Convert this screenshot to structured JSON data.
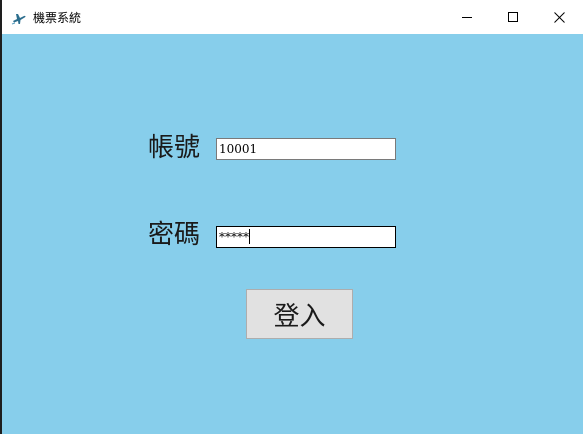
{
  "window": {
    "title": "機票系統",
    "app_icon": "airplane-icon",
    "controls": {
      "minimize_icon": "minimize-icon",
      "maximize_icon": "maximize-icon",
      "close_icon": "close-icon"
    }
  },
  "form": {
    "account_label": "帳號",
    "account_value": "10001",
    "password_label": "密碼",
    "password_value": "*****",
    "login_button_label": "登入"
  },
  "colors": {
    "background": "#87ceeb",
    "titlebar": "#ffffff",
    "button": "#e1e1e1"
  }
}
